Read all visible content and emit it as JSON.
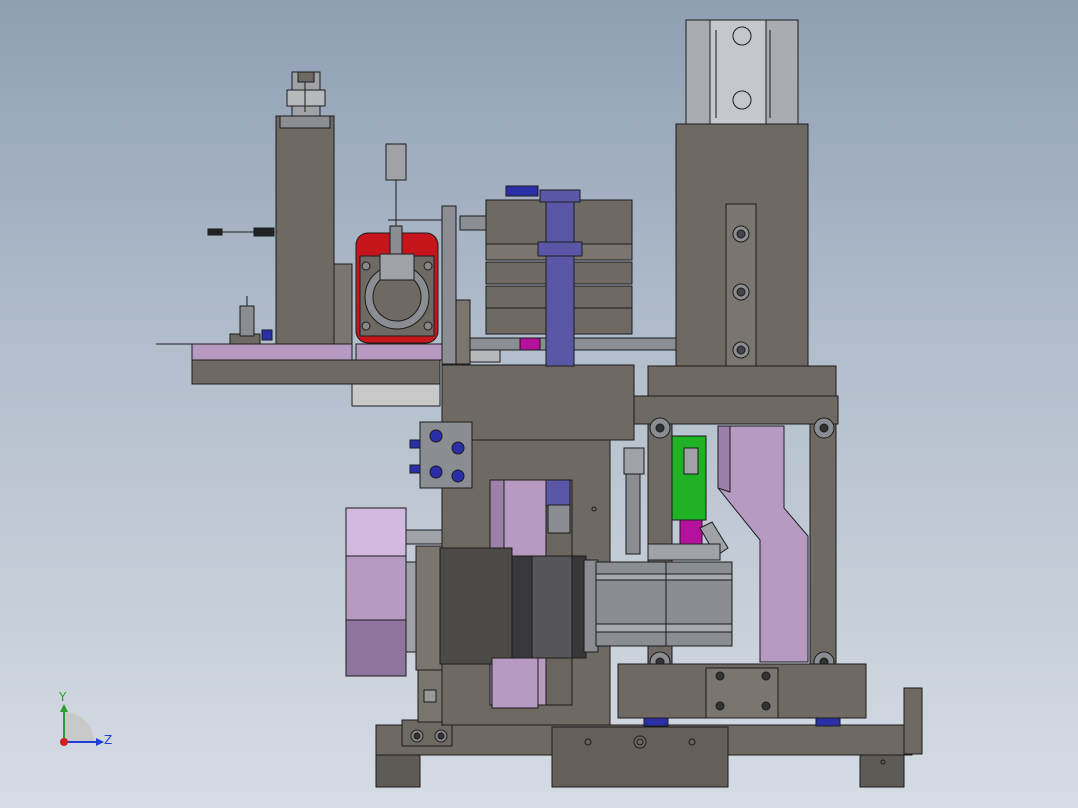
{
  "triad": {
    "y_label": "Y",
    "z_label": "Z"
  },
  "colors": {
    "frame": "#6e6962",
    "frame_dark": "#575350",
    "edge": "#1c1c1c",
    "lavender": "#b79ac2",
    "lavender_dark": "#9d80aa",
    "red_motor": "#c6161b",
    "green_part": "#21b124",
    "blue_bolt": "#2a2fa8",
    "purple_shaft": "#5a57a7",
    "magenta": "#b4119c",
    "steel": "#8a8d91",
    "motor_dark": "#45454a",
    "axis_y": "#2ca02c",
    "axis_z": "#1f3fd8",
    "axis_origin": "#d62020"
  }
}
